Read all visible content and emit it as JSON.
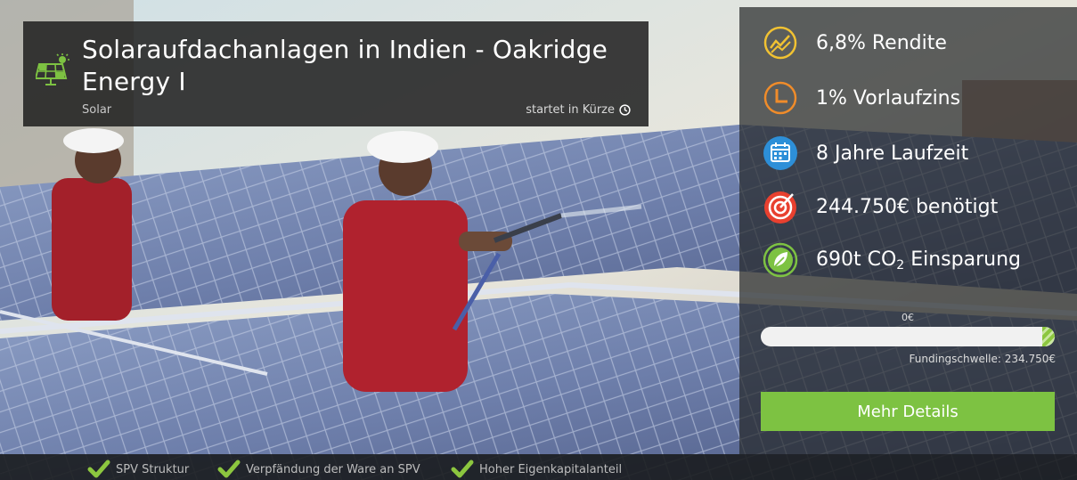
{
  "project": {
    "title": "Solaraufdachanlagen in Indien - Oakridge Energy I",
    "category": "Solar",
    "status": "startet in Kürze",
    "icon": "solar-panel-icon"
  },
  "kpis": [
    {
      "icon": "yield-chart-icon",
      "text": "6,8% Rendite",
      "color": "#f1c232"
    },
    {
      "icon": "clock-icon",
      "text": "1% Vorlaufzins",
      "color": "#f08c2a"
    },
    {
      "icon": "calendar-icon",
      "text": "8 Jahre Laufzeit",
      "color": "#2d8fd8"
    },
    {
      "icon": "target-icon",
      "text": "244.750€ benötigt",
      "color": "#e8402f"
    },
    {
      "icon": "leaf-icon",
      "text_before": "690t CO",
      "text_sub": "2",
      "text_after": " Einsparung",
      "color": "#7dc242"
    }
  ],
  "funding": {
    "current": "0€",
    "threshold_label": "Fundingschwelle: 234.750€",
    "progress": 0
  },
  "details_button": "Mehr Details",
  "features": [
    {
      "label": "SPV Struktur",
      "icon": "check-icon"
    },
    {
      "label": "Verpfändung der Ware an SPV",
      "icon": "check-icon"
    },
    {
      "label": "Hoher Eigenkapitalanteil",
      "icon": "check-icon"
    }
  ],
  "colors": {
    "accent": "#7dc242",
    "check": "#8cc63f"
  }
}
